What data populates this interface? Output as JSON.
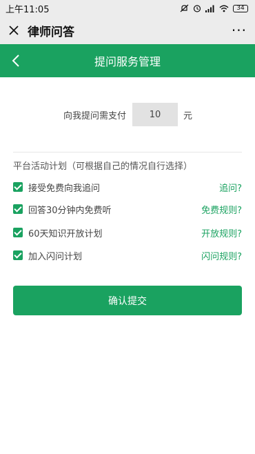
{
  "status_bar": {
    "time": "上午11:05",
    "battery": "34"
  },
  "app": {
    "title": "律师问答",
    "more_glyph": "···"
  },
  "nav": {
    "title": "提问服务管理"
  },
  "payment": {
    "label": "向我提问需支付",
    "amount": "10",
    "unit": "元"
  },
  "plan": {
    "title": "平台活动计划（可根据自己的情况自行选择）",
    "items": [
      {
        "label": "接受免费向我追问",
        "link": "追问?",
        "checked": true
      },
      {
        "label": "回答30分钟内免费听",
        "link": "免费规则?",
        "checked": true
      },
      {
        "label": "60天知识开放计划",
        "link": "开放规则?",
        "checked": true
      },
      {
        "label": "加入闪问计划",
        "link": "闪问规则?",
        "checked": true
      }
    ]
  },
  "submit_label": "确认提交",
  "colors": {
    "accent": "#1aa260",
    "chrome": "#ececec"
  }
}
